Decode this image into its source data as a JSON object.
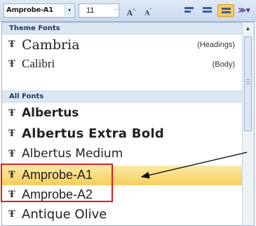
{
  "toolbar": {
    "font_name": "Amprobe-A1",
    "font_size": "11",
    "grow_font": "A",
    "shrink_font": "A",
    "dropdown_glyph": "▾",
    "size_dropdown_glyph": "-"
  },
  "font_menu": {
    "theme_fonts_header": "Theme Fonts",
    "theme_fonts": [
      {
        "name": "Cambria",
        "tag": "(Headings)"
      },
      {
        "name": "Calibri",
        "tag": "(Body)"
      }
    ],
    "all_fonts_header": "All Fonts",
    "all_fonts": [
      {
        "name": "Albertus"
      },
      {
        "name": "Albertus Extra Bold"
      },
      {
        "name": "Albertus Medium"
      },
      {
        "name": "Amprobe-A1",
        "selected": true
      },
      {
        "name": "Amprobe-A2"
      },
      {
        "name": "Antique Olive"
      }
    ],
    "font_icon_glyph": "Ŧ",
    "scroll_up_glyph": "▲"
  },
  "annotation": {
    "highlight_color": "#e01b1b",
    "arrow_color": "#000000"
  },
  "colors": {
    "selected_row": "#f6cf5c",
    "section_header_bg": "#dde7f3"
  }
}
